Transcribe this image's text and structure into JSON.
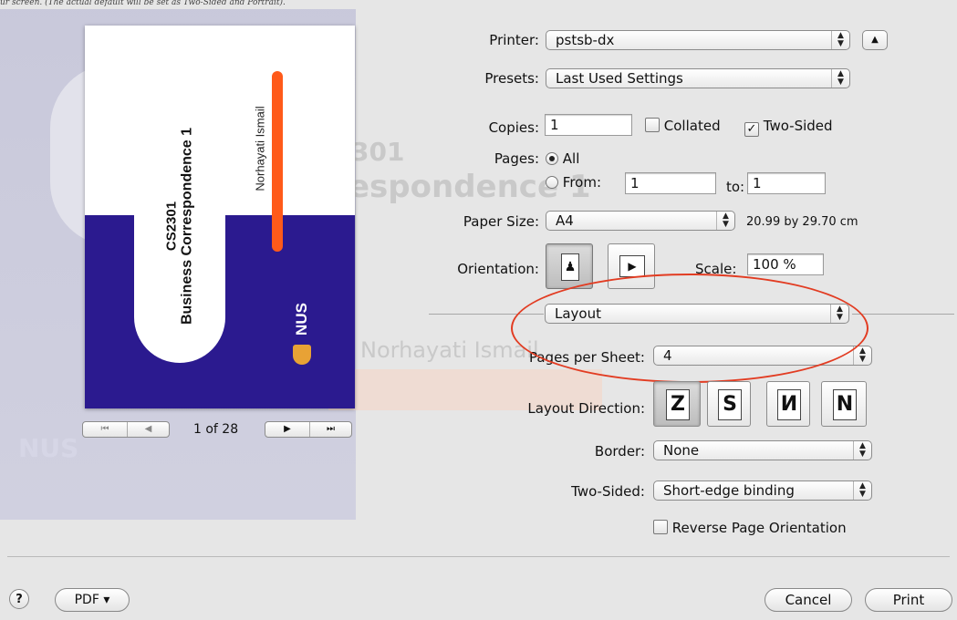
{
  "window": {
    "top_caption": "ur screen. (The actual default will be set as Two-Sided and Portrait)."
  },
  "background": {
    "heading_line1": "301",
    "heading_line2": "espondence 1",
    "author": "Norhayati Ismail"
  },
  "preview": {
    "course_code": "CS2301",
    "course_title": "Business Correspondence 1",
    "author": "Norhayati Ismail",
    "logo_text": "NUS",
    "page_indicator": "1 of 28",
    "first_icon": "⏮",
    "prev_icon": "◀",
    "next_icon": "▶",
    "last_icon": "⏭"
  },
  "printer": {
    "label": "Printer:",
    "value": "pstsb-dx"
  },
  "presets": {
    "label": "Presets:",
    "value": "Last Used Settings"
  },
  "copies": {
    "label": "Copies:",
    "value": "1",
    "collated_label": "Collated",
    "collated": false,
    "two_sided_label": "Two-Sided",
    "two_sided": true
  },
  "pages": {
    "label": "Pages:",
    "all_label": "All",
    "from_label": "From:",
    "from_value": "1",
    "to_label": "to:",
    "to_value": "1"
  },
  "paper_size": {
    "label": "Paper Size:",
    "value": "A4",
    "dimensions": "20.99 by 29.70 cm"
  },
  "orientation": {
    "label": "Orientation:",
    "scale_label": "Scale:",
    "scale_value": "100 %"
  },
  "section": {
    "value": "Layout"
  },
  "layout": {
    "pages_per_sheet_label": "Pages per Sheet:",
    "pages_per_sheet_value": "4",
    "direction_label": "Layout Direction:",
    "border_label": "Border:",
    "border_value": "None",
    "two_sided_label": "Two-Sided:",
    "two_sided_value": "Short-edge binding",
    "reverse_label": "Reverse Page Orientation"
  },
  "footer": {
    "help": "?",
    "pdf_label": "PDF ▾",
    "cancel_label": "Cancel",
    "print_label": "Print"
  },
  "colors": {
    "accent_annotation": "#e23c22",
    "cover_blue": "#2b1a8f",
    "cover_orange": "#ff5a1a"
  }
}
